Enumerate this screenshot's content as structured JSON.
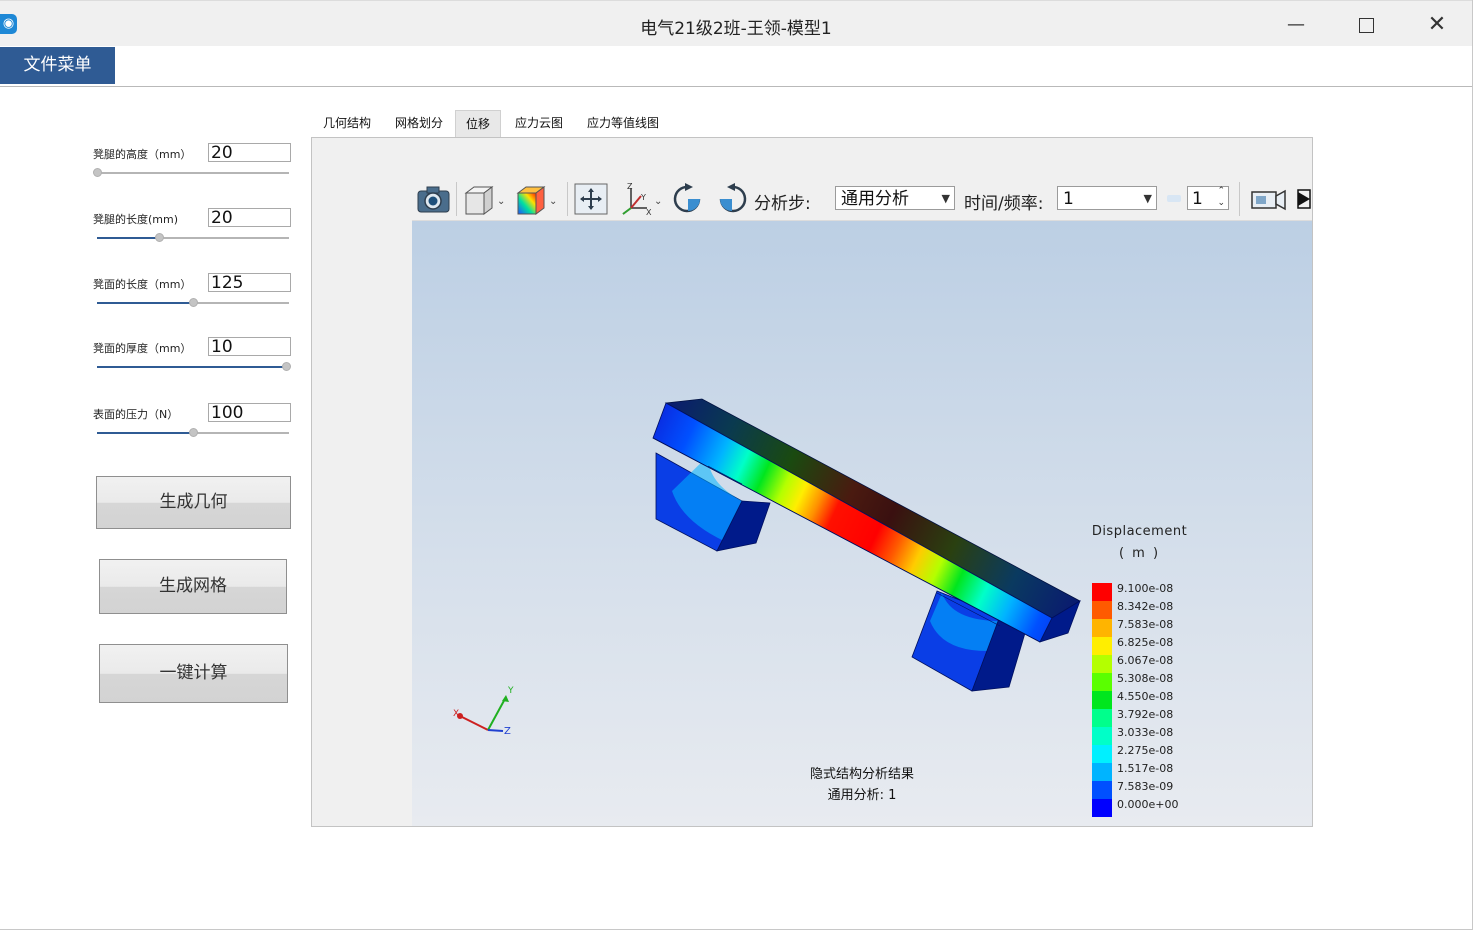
{
  "window": {
    "title": "电气21级2班-王领-模型1"
  },
  "menu": {
    "file_menu": "文件菜单"
  },
  "params": [
    {
      "label": "凳腿的高度（mm）",
      "value": "20",
      "slider_fraction": 0.0
    },
    {
      "label": "凳腿的长度(mm)",
      "value": "20",
      "slider_fraction": 0.33
    },
    {
      "label": "凳面的长度（mm）",
      "value": "125",
      "slider_fraction": 0.5
    },
    {
      "label": "凳面的厚度（mm）",
      "value": "10",
      "slider_fraction": 1.0
    },
    {
      "label": "表面的压力（N）",
      "value": "100",
      "slider_fraction": 0.5
    }
  ],
  "buttons": {
    "gen_geometry": "生成几何",
    "gen_mesh": "生成网格",
    "compute": "一键计算"
  },
  "tabs": [
    "几何结构",
    "网格划分",
    "位移",
    "应力云图",
    "应力等值线图"
  ],
  "active_tab": "位移",
  "toolbar": {
    "analysis_step_label": "分析步:",
    "analysis_step_value": "通用分析",
    "time_freq_label": "时间/频率:",
    "time_freq_value": "1",
    "spin_value": "1"
  },
  "viewport": {
    "result_title": "隐式结构分析结果",
    "result_subtitle": "通用分析: 1",
    "axis_labels": {
      "x": "X",
      "y": "Y",
      "z": "Z"
    },
    "legend": {
      "title": "Displacement",
      "unit": "( m )",
      "values": [
        "9.100e-08",
        "8.342e-08",
        "7.583e-08",
        "6.825e-08",
        "6.067e-08",
        "5.308e-08",
        "4.550e-08",
        "3.792e-08",
        "3.033e-08",
        "2.275e-08",
        "1.517e-08",
        "7.583e-09",
        "0.000e+00"
      ],
      "colors": [
        "#ff0000",
        "#ff5a00",
        "#ffb400",
        "#ffee00",
        "#b4ff00",
        "#5aff00",
        "#00e61e",
        "#00ff8c",
        "#00ffc8",
        "#00f0ff",
        "#00b4ff",
        "#0050ff",
        "#0000ff"
      ]
    }
  }
}
